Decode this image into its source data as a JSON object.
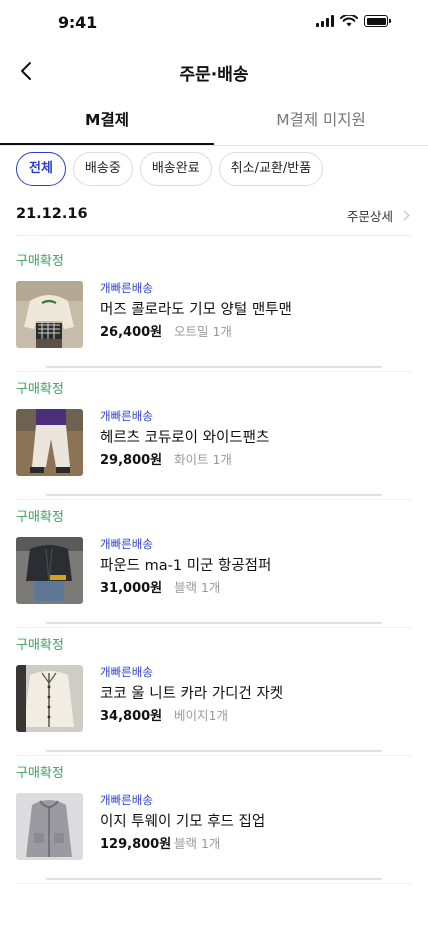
{
  "status_bar": {
    "time": "9:41"
  },
  "header": {
    "title": "주문·배송"
  },
  "tabs": [
    {
      "label": "M결제",
      "active": true
    },
    {
      "label": "M결제 미지원",
      "active": false
    }
  ],
  "filters": [
    {
      "label": "전체",
      "selected": true
    },
    {
      "label": "배송중",
      "selected": false
    },
    {
      "label": "배송완료",
      "selected": false
    },
    {
      "label": "취소/교환/반품",
      "selected": false
    }
  ],
  "order_group": {
    "date": "21.12.16",
    "detail_label": "주문상세"
  },
  "orders": [
    {
      "status": "구매확정",
      "badge": "개빠른배송",
      "name": "머즈 콜로라도 기모 양털 맨투맨",
      "price": "26,400원",
      "option": "오트밀 1개",
      "thumb_icon": "product-photo-sweatshirt"
    },
    {
      "status": "구매확정",
      "badge": "개빠른배송",
      "name": " 헤르츠 코듀로이 와이드팬츠",
      "price": "29,800원",
      "option": "화이트 1개",
      "thumb_icon": "product-photo-pants"
    },
    {
      "status": "구매확정",
      "badge": "개빠른배송",
      "name": "파운드 ma-1 미군 항공점퍼",
      "price": "31,000원",
      "option": "블랙 1개",
      "thumb_icon": "product-photo-jacket"
    },
    {
      "status": "구매확정",
      "badge": "개빠른배송",
      "name": "코코 울 니트 카라 가디건 자켓",
      "price": "34,800원",
      "option": "베이지1개",
      "thumb_icon": "product-photo-cardigan"
    },
    {
      "status": "구매확정",
      "badge": "개빠른배송",
      "name": "이지 투웨이 기모 후드 집업",
      "price": "129,800원",
      "option": "블랙 1개",
      "thumb_icon": "product-photo-hoodie"
    }
  ],
  "colors": {
    "accent": "#2b3fc7",
    "confirmed": "#3aa35d",
    "muted": "#9a9a9a"
  }
}
